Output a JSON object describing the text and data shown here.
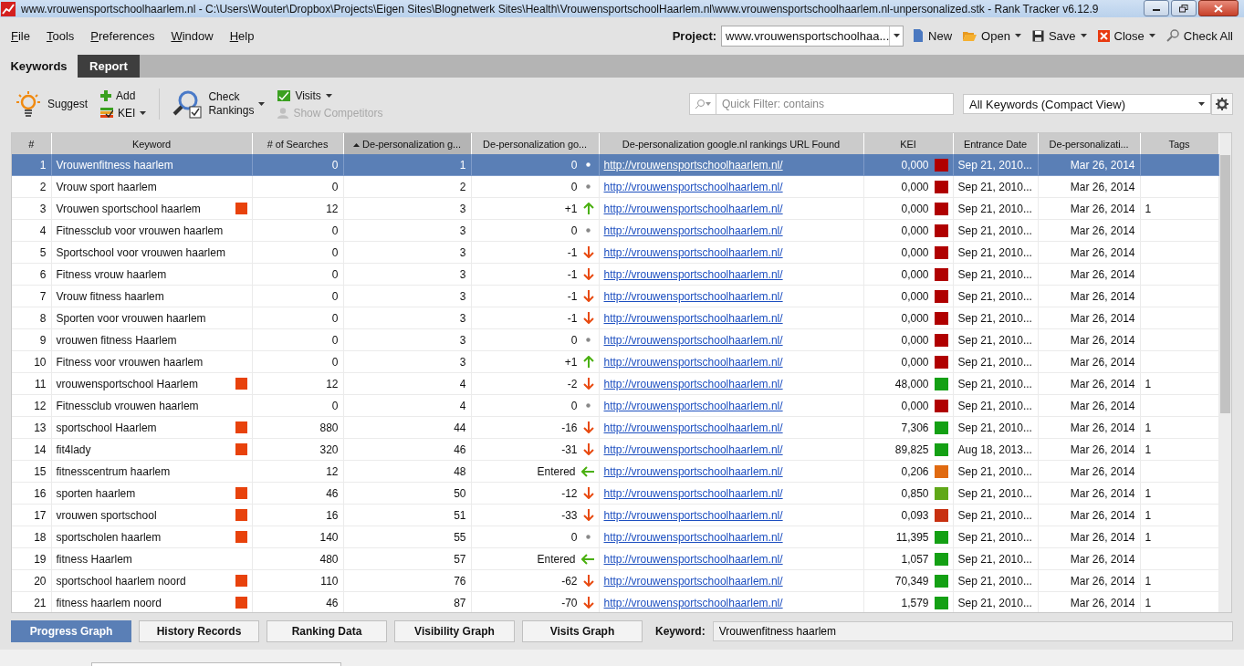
{
  "window": {
    "title": "www.vrouwensportschoolhaarlem.nl - C:\\Users\\Wouter\\Dropbox\\Projects\\Eigen Sites\\Blognetwerk Sites\\Health\\VrouwensportschoolHaarlem.nl\\www.vrouwensportschoolhaarlem.nl-unpersonalized.stk - Rank Tracker v6.12.9"
  },
  "menu": [
    "File",
    "Tools",
    "Preferences",
    "Window",
    "Help"
  ],
  "project": {
    "label": "Project:",
    "value": "www.vrouwensportschoolhaa..."
  },
  "project_actions": [
    {
      "kind": "new",
      "label": "New",
      "dropdown": false
    },
    {
      "kind": "open",
      "label": "Open",
      "dropdown": true
    },
    {
      "kind": "save",
      "label": "Save",
      "dropdown": true
    },
    {
      "kind": "close",
      "label": "Close",
      "dropdown": true
    },
    {
      "kind": "checkall",
      "label": "Check All",
      "dropdown": false
    }
  ],
  "tabs": [
    {
      "label": "Keywords",
      "selected": true
    },
    {
      "label": "Report",
      "selected": false
    }
  ],
  "toolbar": [
    {
      "kind": "suggest",
      "label": "Suggest",
      "dropdown": false,
      "disabled": false
    },
    {
      "kind": "add",
      "label": "Add",
      "dropdown": false,
      "disabled": false
    },
    {
      "kind": "kei",
      "label": "KEI",
      "dropdown": true,
      "disabled": false
    },
    {
      "kind": "check",
      "label": "Check Rankings",
      "dropdown": true,
      "disabled": false
    },
    {
      "kind": "visits",
      "label": "Visits",
      "dropdown": true,
      "disabled": false
    },
    {
      "kind": "competitors",
      "label": "Show Competitors",
      "dropdown": false,
      "disabled": true
    }
  ],
  "filter": {
    "placeholder": "Quick Filter: contains"
  },
  "view_select": {
    "value": "All Keywords (Compact View)"
  },
  "table": {
    "columns": [
      {
        "label": "#",
        "sorted": false
      },
      {
        "label": "Keyword",
        "sorted": false
      },
      {
        "label": "# of Searches",
        "sorted": false
      },
      {
        "label": "De-personalization g...",
        "sorted": true
      },
      {
        "label": "De-personalization go...",
        "sorted": false
      },
      {
        "label": "De-personalization google.nl rankings URL Found",
        "sorted": false
      },
      {
        "label": "KEI",
        "sorted": false
      },
      {
        "label": "Entrance Date",
        "sorted": false
      },
      {
        "label": "De-personalizati...",
        "sorted": false
      },
      {
        "label": "Tags",
        "sorted": false
      }
    ],
    "rows": [
      {
        "num": "1",
        "keyword": "Vrouwenfitness haarlem",
        "marked": false,
        "searches": "0",
        "rank": "1",
        "change": "0",
        "kind": "same",
        "url": "http://vrouwensportschoolhaarlem.nl/",
        "kei": "0,000",
        "color": "#b00000",
        "entrance_date": "Sep 21, 2010...",
        "date": "Mar 26, 2014",
        "selected": true
      },
      {
        "num": "2",
        "keyword": "Vrouw sport haarlem",
        "marked": false,
        "searches": "0",
        "rank": "2",
        "change": "0",
        "kind": "same",
        "url": "http://vrouwensportschoolhaarlem.nl/",
        "kei": "0,000",
        "color": "#b00000",
        "entrance_date": "Sep 21, 2010...",
        "date": "Mar 26, 2014",
        "selected": false
      },
      {
        "num": "3",
        "keyword": "Vrouwen sportschool haarlem",
        "marked": true,
        "searches": "12",
        "rank": "3",
        "change": "+1",
        "kind": "up",
        "url": "http://vrouwensportschoolhaarlem.nl/",
        "kei": "0,000",
        "color": "#b00000",
        "entrance_date": "Sep 21, 2010...",
        "date": "Mar 26, 2014",
        "tags": "1",
        "selected": false
      },
      {
        "num": "4",
        "keyword": "Fitnessclub voor vrouwen haarlem",
        "marked": false,
        "searches": "0",
        "rank": "3",
        "change": "0",
        "kind": "same",
        "url": "http://vrouwensportschoolhaarlem.nl/",
        "kei": "0,000",
        "color": "#b00000",
        "entrance_date": "Sep 21, 2010...",
        "date": "Mar 26, 2014",
        "selected": false
      },
      {
        "num": "5",
        "keyword": "Sportschool voor vrouwen haarlem",
        "marked": false,
        "searches": "0",
        "rank": "3",
        "change": "-1",
        "kind": "down",
        "url": "http://vrouwensportschoolhaarlem.nl/",
        "kei": "0,000",
        "color": "#b00000",
        "entrance_date": "Sep 21, 2010...",
        "date": "Mar 26, 2014",
        "selected": false
      },
      {
        "num": "6",
        "keyword": "Fitness vrouw haarlem",
        "marked": false,
        "searches": "0",
        "rank": "3",
        "change": "-1",
        "kind": "down",
        "url": "http://vrouwensportschoolhaarlem.nl/",
        "kei": "0,000",
        "color": "#b00000",
        "entrance_date": "Sep 21, 2010...",
        "date": "Mar 26, 2014",
        "selected": false
      },
      {
        "num": "7",
        "keyword": "Vrouw fitness haarlem",
        "marked": false,
        "searches": "0",
        "rank": "3",
        "change": "-1",
        "kind": "down",
        "url": "http://vrouwensportschoolhaarlem.nl/",
        "kei": "0,000",
        "color": "#b00000",
        "entrance_date": "Sep 21, 2010...",
        "date": "Mar 26, 2014",
        "selected": false
      },
      {
        "num": "8",
        "keyword": "Sporten voor vrouwen haarlem",
        "marked": false,
        "searches": "0",
        "rank": "3",
        "change": "-1",
        "kind": "down",
        "url": "http://vrouwensportschoolhaarlem.nl/",
        "kei": "0,000",
        "color": "#b00000",
        "entrance_date": "Sep 21, 2010...",
        "date": "Mar 26, 2014",
        "selected": false
      },
      {
        "num": "9",
        "keyword": "vrouwen fitness Haarlem",
        "marked": false,
        "searches": "0",
        "rank": "3",
        "change": "0",
        "kind": "same",
        "url": "http://vrouwensportschoolhaarlem.nl/",
        "kei": "0,000",
        "color": "#b00000",
        "entrance_date": "Sep 21, 2010...",
        "date": "Mar 26, 2014",
        "selected": false
      },
      {
        "num": "10",
        "keyword": "Fitness voor vrouwen haarlem",
        "marked": false,
        "searches": "0",
        "rank": "3",
        "change": "+1",
        "kind": "up",
        "url": "http://vrouwensportschoolhaarlem.nl/",
        "kei": "0,000",
        "color": "#b00000",
        "entrance_date": "Sep 21, 2010...",
        "date": "Mar 26, 2014",
        "selected": false
      },
      {
        "num": "11",
        "keyword": "vrouwensportschool Haarlem",
        "marked": true,
        "searches": "12",
        "rank": "4",
        "change": "-2",
        "kind": "down",
        "url": "http://vrouwensportschoolhaarlem.nl/",
        "kei": "48,000",
        "color": "#14a014",
        "entrance_date": "Sep 21, 2010...",
        "date": "Mar 26, 2014",
        "tags": "1",
        "selected": false
      },
      {
        "num": "12",
        "keyword": "Fitnessclub vrouwen haarlem",
        "marked": false,
        "searches": "0",
        "rank": "4",
        "change": "0",
        "kind": "same",
        "url": "http://vrouwensportschoolhaarlem.nl/",
        "kei": "0,000",
        "color": "#b00000",
        "entrance_date": "Sep 21, 2010...",
        "date": "Mar 26, 2014",
        "selected": false
      },
      {
        "num": "13",
        "keyword": "sportschool Haarlem",
        "marked": true,
        "searches": "880",
        "rank": "44",
        "change": "-16",
        "kind": "down",
        "url": "http://vrouwensportschoolhaarlem.nl/",
        "kei": "7,306",
        "color": "#14a014",
        "entrance_date": "Sep 21, 2010...",
        "date": "Mar 26, 2014",
        "tags": "1",
        "selected": false
      },
      {
        "num": "14",
        "keyword": "fit4lady",
        "marked": true,
        "searches": "320",
        "rank": "46",
        "change": "-31",
        "kind": "down",
        "url": "http://vrouwensportschoolhaarlem.nl/",
        "kei": "89,825",
        "color": "#14a014",
        "entrance_date": "Aug 18, 2013...",
        "date": "Mar 26, 2014",
        "tags": "1",
        "selected": false
      },
      {
        "num": "15",
        "keyword": "fitnesscentrum haarlem",
        "marked": false,
        "searches": "12",
        "rank": "48",
        "change": "Entered",
        "kind": "entered",
        "url": "http://vrouwensportschoolhaarlem.nl/",
        "kei": "0,206",
        "color": "#e06a10",
        "entrance_date": "Sep 21, 2010...",
        "date": "Mar 26, 2014",
        "selected": false
      },
      {
        "num": "16",
        "keyword": "sporten haarlem",
        "marked": true,
        "searches": "46",
        "rank": "50",
        "change": "-12",
        "kind": "down",
        "url": "http://vrouwensportschoolhaarlem.nl/",
        "kei": "0,850",
        "color": "#60a818",
        "entrance_date": "Sep 21, 2010...",
        "date": "Mar 26, 2014",
        "tags": "1",
        "selected": false
      },
      {
        "num": "17",
        "keyword": "vrouwen sportschool",
        "marked": true,
        "searches": "16",
        "rank": "51",
        "change": "-33",
        "kind": "down",
        "url": "http://vrouwensportschoolhaarlem.nl/",
        "kei": "0,093",
        "color": "#c83010",
        "entrance_date": "Sep 21, 2010...",
        "date": "Mar 26, 2014",
        "tags": "1",
        "selected": false
      },
      {
        "num": "18",
        "keyword": "sportscholen haarlem",
        "marked": true,
        "searches": "140",
        "rank": "55",
        "change": "0",
        "kind": "same",
        "url": "http://vrouwensportschoolhaarlem.nl/",
        "kei": "11,395",
        "color": "#14a014",
        "entrance_date": "Sep 21, 2010...",
        "date": "Mar 26, 2014",
        "tags": "1",
        "selected": false
      },
      {
        "num": "19",
        "keyword": "fitness Haarlem",
        "marked": false,
        "searches": "480",
        "rank": "57",
        "change": "Entered",
        "kind": "entered",
        "url": "http://vrouwensportschoolhaarlem.nl/",
        "kei": "1,057",
        "color": "#14a014",
        "entrance_date": "Sep 21, 2010...",
        "date": "Mar 26, 2014",
        "selected": false
      },
      {
        "num": "20",
        "keyword": "sportschool haarlem noord",
        "marked": true,
        "searches": "110",
        "rank": "76",
        "change": "-62",
        "kind": "down",
        "url": "http://vrouwensportschoolhaarlem.nl/",
        "kei": "70,349",
        "color": "#14a014",
        "entrance_date": "Sep 21, 2010...",
        "date": "Mar 26, 2014",
        "tags": "1",
        "selected": false
      },
      {
        "num": "21",
        "keyword": "fitness haarlem noord",
        "marked": true,
        "searches": "46",
        "rank": "87",
        "change": "-70",
        "kind": "down",
        "url": "http://vrouwensportschoolhaarlem.nl/",
        "kei": "1,579",
        "color": "#14a014",
        "entrance_date": "Sep 21, 2010...",
        "date": "Mar 26, 2014",
        "tags": "1",
        "selected": false
      }
    ]
  },
  "bottom_tabs": [
    {
      "label": "Progress Graph",
      "selected": true
    },
    {
      "label": "History Records",
      "selected": false
    },
    {
      "label": "Ranking Data",
      "selected": false
    },
    {
      "label": "Visibility Graph",
      "selected": false
    },
    {
      "label": "Visits Graph",
      "selected": false
    }
  ],
  "keyword_field": {
    "label": "Keyword:",
    "value": "Vrouwenfitness haarlem"
  }
}
